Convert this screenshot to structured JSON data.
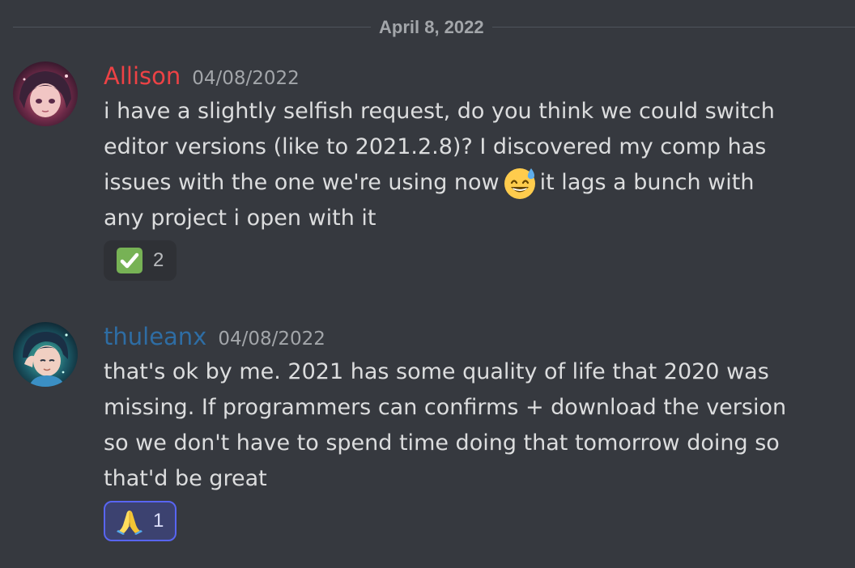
{
  "divider": {
    "date_label": "April 8, 2022"
  },
  "messages": [
    {
      "username": "Allison",
      "username_color": "#ed4245",
      "timestamp": "04/08/2022",
      "lines": [
        "i have a slightly selfish request, do you think we could switch",
        "editor versions (like to 2021.2.8)? I discovered my comp has"
      ],
      "line3_before": "issues with the one we're using now",
      "inline_emoji": "sweat-smile-emoji",
      "line3_after": "it lags a bunch with",
      "line4": "any project i open with it",
      "reaction": {
        "emoji": "check-mark-button-emoji",
        "count": "2",
        "reacted": false
      }
    },
    {
      "username": "thuleanx",
      "username_color": "#2e6da4",
      "timestamp": "04/08/2022",
      "lines": [
        "that's ok by me. 2021 has some quality of life that 2020 was",
        "missing. If programmers can confirms + download the version",
        "so we don't have to spend time doing that tomorrow doing so",
        "that'd be great"
      ],
      "reaction": {
        "emoji": "folded-hands-emoji",
        "count": "1",
        "reacted": true
      }
    }
  ],
  "colors": {
    "background": "#36393f",
    "text": "#dcddde",
    "muted": "#a3a6aa",
    "reaction_bg": "#2f3136",
    "reaction_active_border": "#5865f2"
  }
}
